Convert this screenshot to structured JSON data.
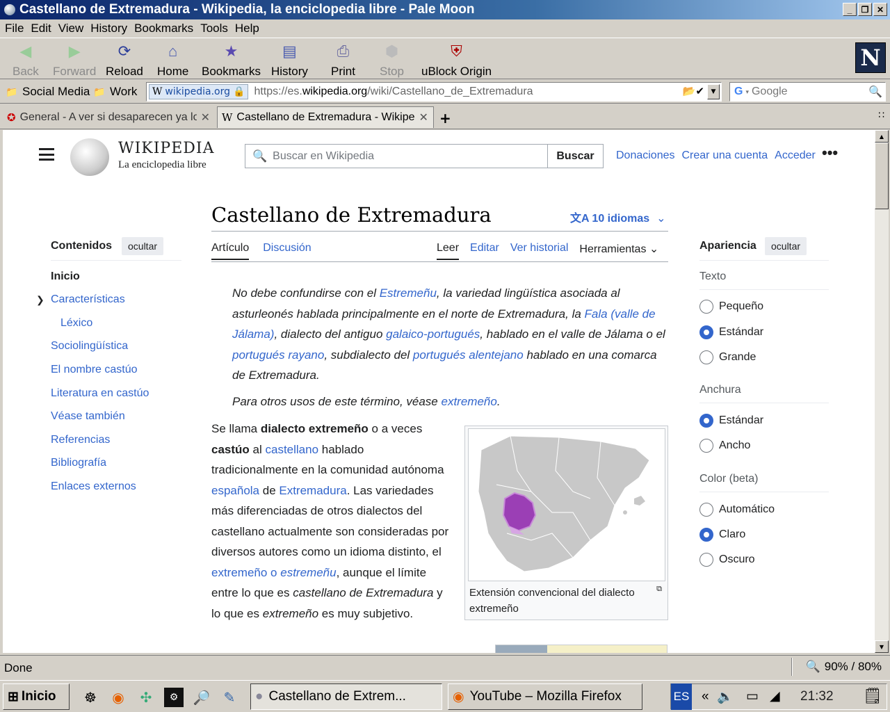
{
  "window": {
    "title": "Castellano de Extremadura - Wikipedia, la enciclopedia libre - Pale Moon",
    "controls": [
      "_",
      "❐",
      "✕"
    ]
  },
  "menu": [
    "File",
    "Edit",
    "View",
    "History",
    "Bookmarks",
    "Tools",
    "Help"
  ],
  "toolbar": {
    "back": "Back",
    "forward": "Forward",
    "reload": "Reload",
    "home": "Home",
    "bookmarks": "Bookmarks",
    "history": "History",
    "print": "Print",
    "stop": "Stop",
    "ublock": "uBlock Origin"
  },
  "bookmarks_bar": {
    "social": "Social Media",
    "work": "Work"
  },
  "urlbar": {
    "identity": "wikipedia.org",
    "url_prefix": "https://es.",
    "url_domain": "wikipedia.org",
    "url_path": "/wiki/Castellano_de_Extremadura"
  },
  "search": {
    "placeholder": "Google"
  },
  "tabs": [
    {
      "label": "General - A ver si desaparecen ya lo",
      "active": false
    },
    {
      "label": "Castellano de Extremadura - Wikipe",
      "active": true
    }
  ],
  "wiki": {
    "logo_title": "WIKIPEDIA",
    "logo_sub": "La enciclopedia libre",
    "search_placeholder": "Buscar en Wikipedia",
    "search_button": "Buscar",
    "top_links": [
      "Donaciones",
      "Crear una cuenta",
      "Acceder"
    ],
    "article_title": "Castellano de Extremadura",
    "languages": "10 idiomas",
    "tab_article": "Artículo",
    "tab_talk": "Discusión",
    "tab_read": "Leer",
    "tab_edit": "Editar",
    "tab_history": "Ver historial",
    "tab_tools": "Herramientas",
    "toc": {
      "heading": "Contenidos",
      "hide": "ocultar",
      "items": [
        "Inicio",
        "Características",
        "Léxico",
        "Sociolingüística",
        "El nombre castúo",
        "Literatura en castúo",
        "Véase también",
        "Referencias",
        "Bibliografía",
        "Enlaces externos"
      ]
    },
    "appearance": {
      "heading": "Apariencia",
      "hide": "ocultar",
      "text_label": "Texto",
      "text_options": [
        "Pequeño",
        "Estándar",
        "Grande"
      ],
      "width_label": "Anchura",
      "width_options": [
        "Estándar",
        "Ancho"
      ],
      "color_label": "Color (beta)",
      "color_options": [
        "Automático",
        "Claro",
        "Oscuro"
      ],
      "selected": {
        "text": "Estándar",
        "width": "Estándar",
        "color": "Claro"
      }
    },
    "hatnote": {
      "t1": "No debe confundirse con el ",
      "l1": "Estremeñu",
      "t2": ", la variedad lingüística asociada al asturleonés hablada principalmente en el norte de Extremadura, la ",
      "l2": "Fala (valle de Jálama)",
      "t3": ", dialecto del antiguo ",
      "l3": "galaico-portugués",
      "t4": ", hablado en el valle de Jálama o el ",
      "l4": "portugués rayano",
      "t5": ", subdialecto del ",
      "l5": "portugués alentejano",
      "t6": " hablado en una comarca de Extremadura."
    },
    "hatnote2": {
      "t1": "Para otros usos de este término, véase ",
      "l1": "extremeño",
      "t2": "."
    },
    "body": {
      "t1": "Se llama ",
      "b1": "dialecto extremeño",
      "t2": " o a veces ",
      "b2": "castúo",
      "t3": " al ",
      "l1": "castellano",
      "t4": " hablado tradicionalmente en la comunidad autónoma ",
      "l2": "española",
      "t5": " de ",
      "l3": "Extremadura",
      "t6": ". Las variedades más diferenciadas de otros dialectos del castellano actualmente son consideradas por diversos autores como un idioma distinto, el ",
      "l4": "extremeño o ",
      "l4i": "estremeñu",
      "t7": ", aunque el límite entre lo que es ",
      "i1": "castellano de Extremadura",
      "t8": " y lo que es ",
      "i2": "extremeño",
      "t9": " es muy subjetivo."
    },
    "map_caption": "Extensión convencional del dialecto extremeño"
  },
  "status": {
    "text": "Done",
    "zoom": "90% / 80%"
  },
  "taskbar": {
    "start": "Inicio",
    "windows": [
      "Castellano de Extrem...",
      "YouTube – Mozilla Firefox"
    ],
    "lang": "ES",
    "clock": "21:32"
  },
  "colors": {
    "link": "#3366cc",
    "title_gradient_start": "#0a246a",
    "region": "#9b3fb5"
  }
}
